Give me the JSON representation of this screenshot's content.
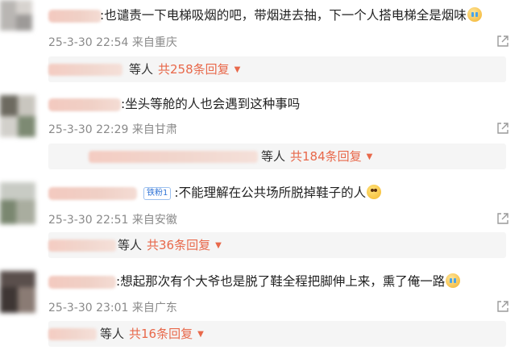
{
  "comments": [
    {
      "text": ":也谴责一下电梯吸烟的吧，带烟进去抽，下一个人搭电梯全是烟味",
      "emoji": "crying-face",
      "date": "25-3-30 22:54",
      "location": "来自重庆",
      "reply_by": "等人",
      "reply_count": "共258条回复"
    },
    {
      "text": ":坐头等舱的人也会遇到这种事吗",
      "emoji": "",
      "date": "25-3-30 22:29",
      "location": "来自甘肃",
      "reply_by": "等人",
      "reply_count": "共184条回复"
    },
    {
      "badge": "铁粉1",
      "text": ":不能理解在公共场所脱掉鞋子的人",
      "emoji": "shocked-face",
      "date": "25-3-30 22:51",
      "location": "来自安徽",
      "reply_by": "等人",
      "reply_count": "共36条回复"
    },
    {
      "text": ":想起那次有个大爷也是脱了鞋全程把脚伸上来，熏了俺一路",
      "emoji": "crying-face",
      "date": "25-3-30 23:01",
      "location": "来自广东",
      "reply_by": "等人",
      "reply_count": "共16条回复"
    }
  ],
  "icons": {
    "share": "share-icon",
    "expand": "caret-down-icon"
  },
  "colors": {
    "accent": "#e8684a",
    "meta": "#8a8a8a",
    "reply_bg": "#f5f5f5"
  }
}
